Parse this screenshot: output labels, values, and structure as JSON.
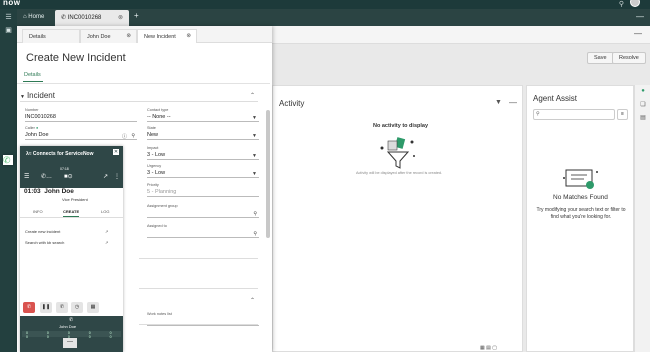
{
  "app": {
    "brand": "now"
  },
  "workspace_tabs": {
    "home": "Home",
    "incident": "INC0010268"
  },
  "record_toolbar": {
    "save": "Save",
    "resolve": "Resolve"
  },
  "modal": {
    "tabs": [
      "Details",
      "John Doe",
      "New Incident"
    ],
    "title": "Create New Incident",
    "subtab": "Details",
    "section": "Incident",
    "fields": {
      "number": {
        "label": "Number",
        "value": "INC0010268"
      },
      "contact_type": {
        "label": "Contact type",
        "value": "-- None --"
      },
      "caller": {
        "label": "Caller",
        "value": "John Doe"
      },
      "state": {
        "label": "State",
        "value": "New"
      },
      "impact": {
        "label": "Impact",
        "value": "3 - Low"
      },
      "urgency": {
        "label": "Urgency",
        "value": "3 - Low"
      },
      "priority": {
        "label": "Priority",
        "value": "5 - Planning"
      },
      "assignment_group": {
        "label": "Assignment group",
        "value": ""
      },
      "assigned_to": {
        "label": "Assigned to",
        "value": ""
      },
      "work_notes_list": {
        "label": "Work notes list",
        "value": ""
      }
    }
  },
  "activity": {
    "title": "Activity",
    "empty_title": "No activity to display",
    "empty_note": "Activity will be displayed after the record is created."
  },
  "agent_assist": {
    "title": "Agent Assist",
    "empty_title": "No Matches Found",
    "empty_hint": "Try modifying your search text or filter to find what you're looking for."
  },
  "softphone": {
    "header": "Connects for ServiceNow",
    "timer": "07:18",
    "call_time": "01:03",
    "caller_name": "John Doe",
    "caller_title": "Vice President",
    "tabs": [
      "INFO",
      "CREATE",
      "LOG"
    ],
    "links": [
      "Create new incident",
      "Search with kb search"
    ],
    "dial_name": "John Doe",
    "dial_digits": "0 0 0 0 0 0 0 0 0 0"
  }
}
